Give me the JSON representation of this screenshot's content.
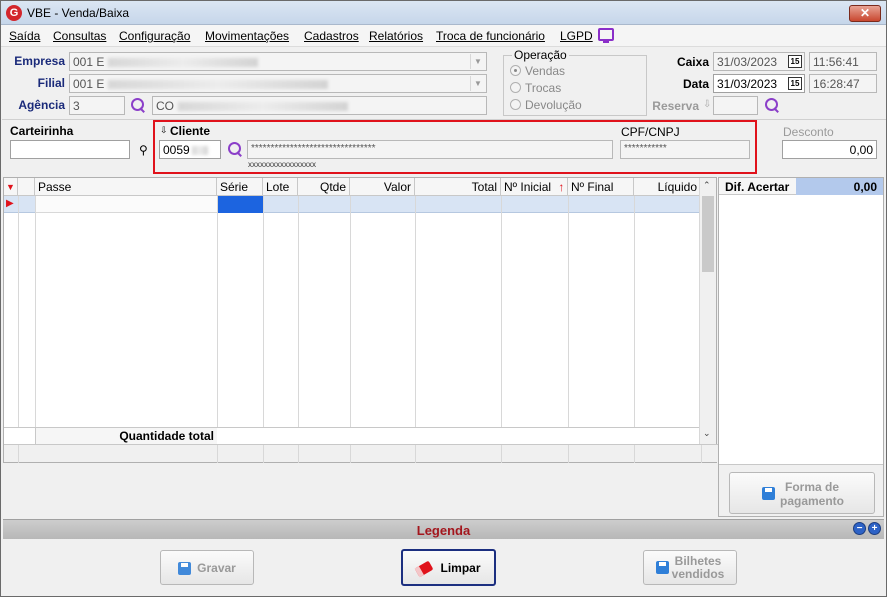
{
  "window": {
    "title": "VBE - Venda/Baixa",
    "app_icon_letter": "G",
    "close_label": "✕"
  },
  "menu": [
    {
      "label": "Saída"
    },
    {
      "label": "Consultas"
    },
    {
      "label": "Configuração"
    },
    {
      "label": "Movimentações"
    },
    {
      "label": "Cadastros"
    },
    {
      "label": "Relatórios"
    },
    {
      "label": "Troca de funcionário"
    },
    {
      "label": "LGPD"
    }
  ],
  "header": {
    "empresa_label": "Empresa",
    "empresa_value": "001 E",
    "filial_label": "Filial",
    "filial_value": "001 E",
    "agencia_label": "Agência",
    "agencia_code": "3",
    "agencia_desc": "CO",
    "operacao_title": "Operação",
    "operacao_options": [
      {
        "label": "Vendas",
        "checked": true
      },
      {
        "label": "Trocas",
        "checked": false
      },
      {
        "label": "Devolução",
        "checked": false
      }
    ],
    "caixa_label": "Caixa",
    "caixa_date": "31/03/2023",
    "caixa_time": "11:56:41",
    "data_label": "Data",
    "data_date": "31/03/2023",
    "data_time": "16:28:47",
    "reserva_label": "Reserva",
    "calendar_label": "15"
  },
  "cliente_section": {
    "carteirinha_label": "Carteirinha",
    "carteirinha_value": "",
    "cliente_label": "Cliente",
    "cliente_code": "0059",
    "cliente_name": "********************************",
    "cliente_sub": "xxxxxxxxxxxxxxxxx",
    "cpf_label": "CPF/CNPJ",
    "cpf_value": "***********",
    "desconto_label": "Desconto",
    "desconto_value": "0,00"
  },
  "grid": {
    "columns": [
      "Passe",
      "Série",
      "Lote",
      "Qtde",
      "Valor",
      "Total",
      "Nº Inicial",
      "Nº Final",
      "Líquido"
    ],
    "footer_label": "Quantidade total"
  },
  "right_panel": {
    "dif_label": "Dif. Acertar",
    "dif_value": "0,00",
    "forma_pagamento_label_1": "Forma de",
    "forma_pagamento_label_2": "pagamento"
  },
  "legend": {
    "label": "Legenda"
  },
  "buttons": {
    "gravar_label": "Gravar",
    "limpar_label": "Limpar",
    "bilhetes_label_1": "Bilhetes",
    "bilhetes_label_2": "vendidos"
  },
  "colors": {
    "highlight_red": "#e0121b",
    "label_blue": "#1a2a7a",
    "dif_value_bg": "#b3c9ec",
    "legend_text": "#a3161d"
  }
}
